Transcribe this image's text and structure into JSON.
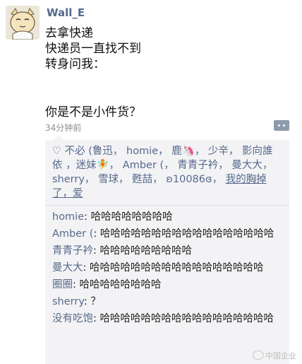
{
  "post": {
    "author": "Wall_E",
    "lines": [
      "去拿快递",
      "快递员一直找不到",
      "转身问我：",
      "你是不是小件货？"
    ],
    "time": "34分钟前"
  },
  "likes": {
    "names": [
      "不必 (鲁迅",
      "homie",
      "鹿🦄",
      "少辛",
      "影向誰依",
      "，迷妹🧚",
      "Amber (",
      "青青子衿",
      "曼大大",
      "sherry",
      "雪球",
      "甦喆",
      "ʚ10086ɞ",
      "我的胸掉了，爱"
    ]
  },
  "comments": [
    {
      "name": "homie",
      "text": "哈哈哈哈哈哈哈哈"
    },
    {
      "name": "Amber (",
      "text": "哈哈哈哈哈哈哈哈哈哈哈哈哈哈哈哈哈"
    },
    {
      "name": "青青子衿",
      "text": "哈哈哈哈哈哈哈哈哈"
    },
    {
      "name": "曼大大",
      "text": "哈哈哈哈哈哈哈哈哈哈哈哈哈哈哈哈哈"
    },
    {
      "name": "圈圈",
      "text": "哈哈哈哈哈哈哈哈"
    },
    {
      "name": "sherry",
      "text": "？"
    },
    {
      "name": "没有吃饱",
      "text": "哈哈哈哈哈哈哈哈哈哈哈哈哈哈哈哈哈"
    }
  ],
  "watermark": "中国企业",
  "colors": {
    "link": "#56698c",
    "comment_bg": "#f3f3f5"
  }
}
